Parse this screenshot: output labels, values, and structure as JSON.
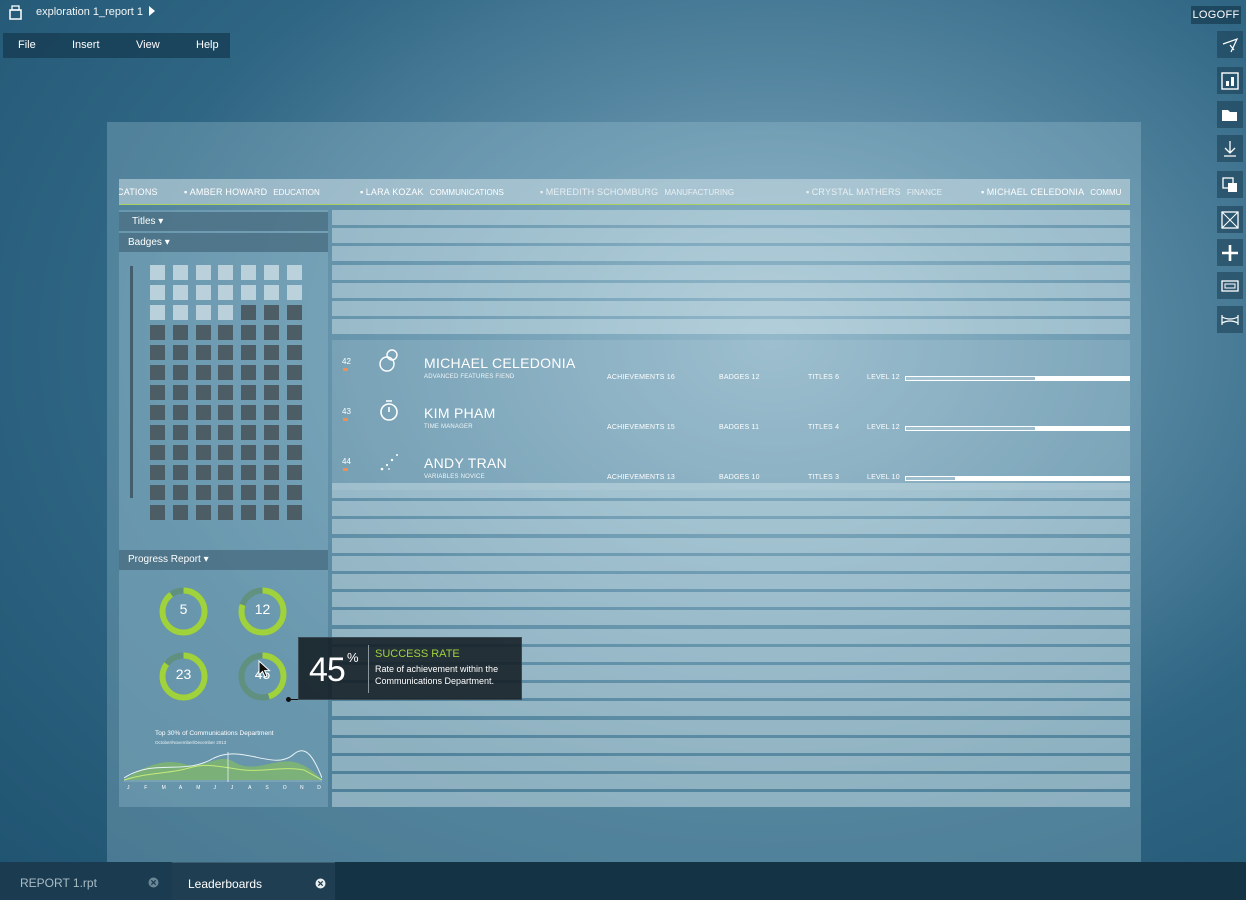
{
  "window": {
    "title": "exploration 1_report 1",
    "logoff": "LOGOFF"
  },
  "menu": [
    "File",
    "Insert",
    "View",
    "Help"
  ],
  "toolbar_icons": [
    "pointer-icon",
    "chart-icon",
    "folder-icon",
    "download-icon",
    "duplicate-icon",
    "crop-icon",
    "add-icon",
    "frame-icon",
    "stretch-icon"
  ],
  "names_bar": [
    {
      "name": "CATIONS",
      "dept": ""
    },
    {
      "name": "AMBER HOWARD",
      "dept": "EDUCATION"
    },
    {
      "name": "LARA KOZAK",
      "dept": "COMMUNICATIONS"
    },
    {
      "name": "MEREDITH SCHOMBURG",
      "dept": "MANUFACTURING"
    },
    {
      "name": "CRYSTAL MATHERS",
      "dept": "FINANCE"
    },
    {
      "name": "MICHAEL CELEDONIA",
      "dept": "COMMU"
    }
  ],
  "left_panel": {
    "titles": "Titles",
    "badges": "Badges",
    "progress": "Progress Report"
  },
  "progress_rings": [
    {
      "value": "5",
      "fraction": 0.9
    },
    {
      "value": "12",
      "fraction": 0.8
    },
    {
      "value": "23",
      "fraction": 0.85
    },
    {
      "value": "45",
      "fraction": 0.45
    }
  ],
  "sparkline": {
    "title": "Top 30% of Communications Department",
    "subtitle": "October/November/December 2013",
    "months": [
      "J",
      "F",
      "M",
      "A",
      "M",
      "J",
      "J",
      "A",
      "S",
      "O",
      "N",
      "D"
    ]
  },
  "leaderboard": [
    {
      "rank": "42",
      "name": "MICHAEL CELEDONIA",
      "title": "ADVANCED FEATURES FIEND",
      "achievements": "ACHIEVEMENTS 16",
      "badges": "BADGES 12",
      "titles": "TITLES 6",
      "level": "LEVEL 12",
      "progress": 0.58,
      "icon": "rings-icon"
    },
    {
      "rank": "43",
      "name": "KIM PHAM",
      "title": "TIME MANAGER",
      "achievements": "ACHIEVEMENTS 15",
      "badges": "BADGES 11",
      "titles": "TITLES 4",
      "level": "LEVEL 12",
      "progress": 0.58,
      "icon": "stopwatch-icon"
    },
    {
      "rank": "44",
      "name": "ANDY TRAN",
      "title": "VARIABLES NOVICE",
      "achievements": "ACHIEVEMENTS 13",
      "badges": "BADGES 10",
      "titles": "TITLES 3",
      "level": "LEVEL 10",
      "progress": 0.22,
      "icon": "scatter-icon"
    }
  ],
  "tooltip": {
    "percent": "45",
    "percent_sign": "%",
    "heading": "SUCCESS RATE",
    "body": "Rate of achievement within the Communications Department."
  },
  "tabs": [
    {
      "label": "REPORT 1.rpt",
      "active": false
    },
    {
      "label": "Leaderboards",
      "active": true
    }
  ],
  "colors": {
    "accent_green": "#9fd23b",
    "rank_marker": "#e7925b"
  }
}
